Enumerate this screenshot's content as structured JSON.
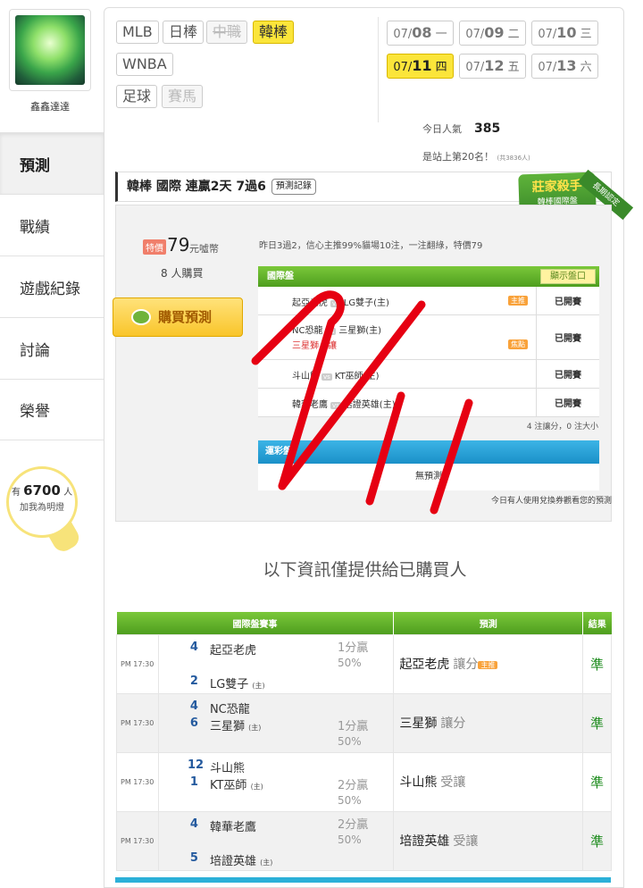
{
  "user": {
    "name": "鑫鑫達達"
  },
  "menu": [
    "預測",
    "戰績",
    "遊戲紀錄",
    "討論",
    "榮譽"
  ],
  "bulb": {
    "prefix": "有",
    "count": "6700",
    "suffix": "人",
    "text": "加我為明燈"
  },
  "leagues": [
    "MLB",
    "日棒",
    "中職",
    "韓棒",
    "WNBA",
    "足球",
    "賽馬"
  ],
  "dates": [
    {
      "md": "07/",
      "day": "08",
      "wd": "一"
    },
    {
      "md": "07/",
      "day": "09",
      "wd": "二"
    },
    {
      "md": "07/",
      "day": "10",
      "wd": "三"
    },
    {
      "md": "07/",
      "day": "11",
      "wd": "四"
    },
    {
      "md": "07/",
      "day": "12",
      "wd": "五"
    },
    {
      "md": "07/",
      "day": "13",
      "wd": "六"
    }
  ],
  "stats": {
    "pop_label": "今日人氣",
    "pop_value": "385",
    "rank": "是站上第20名！",
    "rank_note": "(共3836人)"
  },
  "card": {
    "title": "韓棒 國際 連贏2天 7過6",
    "record_btn": "預測記錄",
    "badge": "莊家殺手",
    "badge_sub": "韓棒國際盤",
    "corner": "長期認定",
    "price_tag": "特價",
    "price": "79",
    "price_unit": "元噓幣",
    "buyers": "8 人購買",
    "buy_label": "購買預測",
    "coin": "噓",
    "summary": "昨日3過2，信心主推99%貓場10注，一注翻綠，特價79",
    "table_title": "國際盤",
    "table_btn": "顯示盤口",
    "rows": [
      {
        "a": "起亞老虎",
        "b": "LG雙子(主)",
        "tag": "主推",
        "status": "已開賽"
      },
      {
        "a": "NC恐龍",
        "b": "三星獅(主)",
        "line2": "三星獅　讓",
        "tag": "焦點",
        "status": "已開賽"
      },
      {
        "a": "斗山熊",
        "b": "KT巫師(主)",
        "status": "已開賽"
      },
      {
        "a": "韓華老鷹",
        "b": "培證英雄(主)",
        "status": "已開賽"
      }
    ],
    "vs": "vs",
    "note": "4 注讓分，0 注大小",
    "table2_title": "運彩盤",
    "table2_empty": "無預測",
    "ticket_note": "今日有人使用兌換券觀看您的預測"
  },
  "info_title": "以下資訊僅提供給已購買人",
  "results": {
    "headers": [
      "國際盤賽事",
      "預測",
      "結果"
    ],
    "home": "(主)",
    "rows": [
      {
        "time": "PM 17:30",
        "s1": "4",
        "t1": "起亞老虎",
        "s2": "2",
        "t2": "LG雙子",
        "spread": "1分贏",
        "pct": "50%",
        "spread_row": "top",
        "pick": "起亞老虎",
        "pnote": "讓分",
        "badge": "主推",
        "res": "準"
      },
      {
        "time": "PM 17:30",
        "s1": "4",
        "t1": "NC恐龍",
        "s2": "6",
        "t2": "三星獅",
        "spread": "1分贏",
        "pct": "50%",
        "spread_row": "bottom",
        "pick": "三星獅",
        "pnote": "讓分",
        "badge": "",
        "res": "準"
      },
      {
        "time": "PM 17:30",
        "s1": "12",
        "t1": "斗山熊",
        "s2": "1",
        "t2": "KT巫師",
        "spread": "2分贏",
        "pct": "50%",
        "spread_row": "bottom",
        "pick": "斗山熊",
        "pnote": "受讓",
        "badge": "",
        "res": "準"
      },
      {
        "time": "PM 17:30",
        "s1": "4",
        "t1": "韓華老鷹",
        "s2": "5",
        "t2": "培證英雄",
        "spread": "2分贏",
        "pct": "50%",
        "spread_row": "top",
        "pick": "培證英雄",
        "pnote": "受讓",
        "badge": "",
        "res": "準"
      }
    ]
  }
}
